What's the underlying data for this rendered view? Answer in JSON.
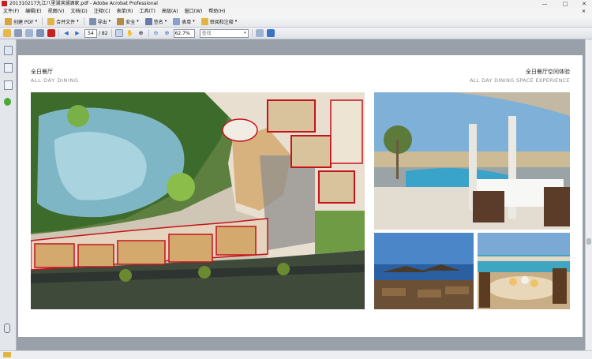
{
  "window": {
    "title": "201310217九江八里湖滨湖酒家.pdf - Adobe Acrobat Professional",
    "minimize": "—",
    "maximize": "□",
    "close": "✕"
  },
  "menu": {
    "items": [
      "文件(F)",
      "编辑(E)",
      "视图(V)",
      "文档(D)",
      "注释(C)",
      "表单(R)",
      "工具(T)",
      "高级(A)",
      "窗口(W)",
      "帮助(H)"
    ],
    "close": "✕"
  },
  "toolbar": {
    "create_pdf": "创建 PDF",
    "combine_files": "合并文件",
    "export": "导出",
    "secure": "安全",
    "sign": "签名",
    "forms": "表单",
    "review_comment": "审阅和注释"
  },
  "navigation": {
    "current_page": "54",
    "page_count": "/ 82",
    "zoom": "62.7%",
    "find_placeholder": "查找"
  },
  "document": {
    "left_title": "全日餐厅",
    "left_subtitle": "ALL DAY DINING",
    "right_title": "全日餐厅空间体验",
    "right_subtitle": "ALL DAY DINING SPACE EXPERIENCE"
  },
  "colors": {
    "acrobat_red": "#c8201e",
    "doc_background": "#9aa0aa",
    "page": "#ffffff",
    "plan_red": "#c3141c",
    "pool_blue": "#6fb3c9"
  }
}
